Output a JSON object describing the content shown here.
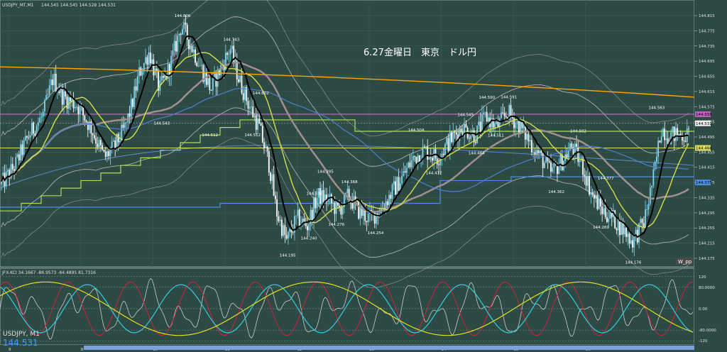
{
  "header": {
    "symbol_info": "USDJPY_MT,M1",
    "ohlc": "144.545 144.545 144.528 144.531"
  },
  "annotation": "6.27金曜日　東京　ドル円",
  "footer": {
    "symbol": "USDJPY, M1",
    "last_price": "144.531"
  },
  "indicator": {
    "label": "JFX-KCI 34.1667 -86.9573 -64.4895 81.7316",
    "levels": [
      "120",
      "80.0000",
      "0.00",
      "-80.0000",
      "-120"
    ]
  },
  "price_tags": {
    "current": "144.531",
    "yellow": "144.466",
    "upper": "144.555",
    "lower": "144.375"
  },
  "badge": "W_pp",
  "colors": {
    "background": "#2e4a44",
    "candle_up": "#7fd4f0",
    "candle_down": "#ffffff",
    "ma_fast": "#000000",
    "ma_mid": "#d6e04a",
    "ma_slow": "#ffa500",
    "ichimoku": "#a09090",
    "bollinger": "#b8b8b8",
    "step_green": "#a8e060",
    "step_blue": "#4a90e0",
    "hline_pink": "#e080e0",
    "hline_yellow": "#e0e060",
    "osc_cyan": "#30d0e0",
    "osc_red": "#d02040",
    "osc_yellow": "#e0e020",
    "osc_white": "#e0e0e0"
  },
  "chart_data": [
    {
      "type": "candlestick",
      "symbol": "USDJPY",
      "timeframe": "M1",
      "yaxis_ticks": [
        144.815,
        144.775,
        144.735,
        144.695,
        144.655,
        144.615,
        144.575,
        144.535,
        144.495,
        144.455,
        144.415,
        144.375,
        144.335,
        144.295,
        144.255,
        144.215,
        144.175
      ],
      "ylim": [
        144.16,
        144.83
      ],
      "xaxis_ticks": [
        "9",
        "9",
        "10",
        "11",
        "12",
        "13",
        "14",
        "15",
        "16"
      ],
      "price_labels": [
        {
          "x": 0.262,
          "value": "144.806"
        },
        {
          "x": 0.333,
          "value": "144.743"
        },
        {
          "x": 0.376,
          "value": "144.602"
        },
        {
          "x": 0.232,
          "value": "144.543"
        },
        {
          "x": 0.302,
          "value": "144.512"
        },
        {
          "x": 0.364,
          "value": "144.512"
        },
        {
          "x": 0.415,
          "value": "144.195"
        },
        {
          "x": 0.446,
          "value": "144.240"
        },
        {
          "x": 0.454,
          "value": "144.337"
        },
        {
          "x": 0.47,
          "value": "144.395"
        },
        {
          "x": 0.486,
          "value": "144.276"
        },
        {
          "x": 0.505,
          "value": "144.368"
        },
        {
          "x": 0.543,
          "value": "144.254"
        },
        {
          "x": 0.602,
          "value": "144.504"
        },
        {
          "x": 0.628,
          "value": "144.412"
        },
        {
          "x": 0.674,
          "value": "144.545"
        },
        {
          "x": 0.69,
          "value": "144.464"
        },
        {
          "x": 0.705,
          "value": "144.590"
        },
        {
          "x": 0.718,
          "value": "144.511"
        },
        {
          "x": 0.737,
          "value": "144.591"
        },
        {
          "x": 0.806,
          "value": "144.362"
        },
        {
          "x": 0.838,
          "value": "144.502"
        },
        {
          "x": 0.878,
          "value": "144.377"
        },
        {
          "x": 0.871,
          "value": "144.269"
        },
        {
          "x": 0.918,
          "value": "144.176"
        },
        {
          "x": 0.952,
          "value": "144.563"
        }
      ],
      "path": [
        [
          0,
          144.37
        ],
        [
          0.02,
          144.42
        ],
        [
          0.04,
          144.5
        ],
        [
          0.06,
          144.55
        ],
        [
          0.075,
          144.65
        ],
        [
          0.09,
          144.6
        ],
        [
          0.11,
          144.58
        ],
        [
          0.13,
          144.52
        ],
        [
          0.15,
          144.44
        ],
        [
          0.165,
          144.47
        ],
        [
          0.18,
          144.52
        ],
        [
          0.19,
          144.58
        ],
        [
          0.2,
          144.66
        ],
        [
          0.215,
          144.72
        ],
        [
          0.23,
          144.62
        ],
        [
          0.245,
          144.68
        ],
        [
          0.262,
          144.79
        ],
        [
          0.275,
          144.74
        ],
        [
          0.29,
          144.68
        ],
        [
          0.305,
          144.62
        ],
        [
          0.315,
          144.66
        ],
        [
          0.333,
          144.73
        ],
        [
          0.345,
          144.65
        ],
        [
          0.36,
          144.58
        ],
        [
          0.375,
          144.52
        ],
        [
          0.39,
          144.42
        ],
        [
          0.4,
          144.3
        ],
        [
          0.415,
          144.22
        ],
        [
          0.43,
          144.28
        ],
        [
          0.445,
          144.26
        ],
        [
          0.46,
          144.34
        ],
        [
          0.475,
          144.33
        ],
        [
          0.49,
          144.3
        ],
        [
          0.505,
          144.34
        ],
        [
          0.52,
          144.3
        ],
        [
          0.535,
          144.28
        ],
        [
          0.55,
          144.3
        ],
        [
          0.565,
          144.34
        ],
        [
          0.58,
          144.38
        ],
        [
          0.6,
          144.44
        ],
        [
          0.615,
          144.46
        ],
        [
          0.635,
          144.44
        ],
        [
          0.65,
          144.48
        ],
        [
          0.67,
          144.52
        ],
        [
          0.69,
          144.5
        ],
        [
          0.705,
          144.55
        ],
        [
          0.72,
          144.52
        ],
        [
          0.737,
          144.56
        ],
        [
          0.755,
          144.52
        ],
        [
          0.77,
          144.48
        ],
        [
          0.785,
          144.44
        ],
        [
          0.8,
          144.4
        ],
        [
          0.815,
          144.43
        ],
        [
          0.83,
          144.47
        ],
        [
          0.845,
          144.42
        ],
        [
          0.86,
          144.34
        ],
        [
          0.875,
          144.3
        ],
        [
          0.89,
          144.28
        ],
        [
          0.905,
          144.25
        ],
        [
          0.918,
          144.22
        ],
        [
          0.935,
          144.27
        ],
        [
          0.95,
          144.4
        ],
        [
          0.96,
          144.52
        ],
        [
          0.97,
          144.5
        ]
      ]
    },
    {
      "type": "line",
      "name": "JFX-KCI",
      "ylim": [
        -130,
        130
      ],
      "levels": [
        120,
        80,
        0,
        -80,
        -120
      ]
    }
  ]
}
